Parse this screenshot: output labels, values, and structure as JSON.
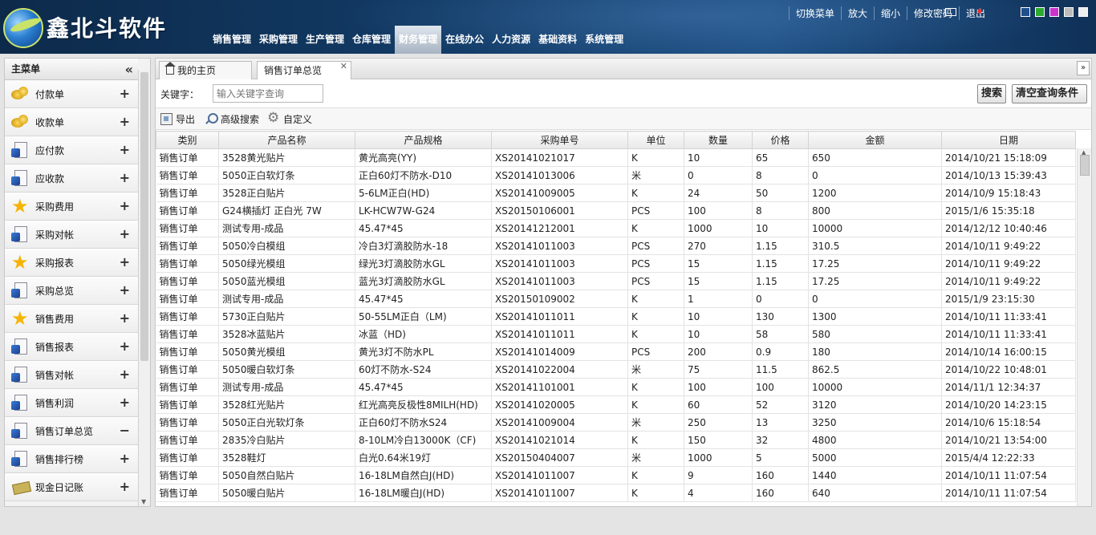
{
  "header": {
    "logo_text": "鑫北斗软件",
    "top_links": [
      "切换菜单",
      "放大",
      "缩小",
      "修改密码",
      "退出"
    ],
    "nav": [
      "销售管理",
      "采购管理",
      "生产管理",
      "仓库管理",
      "财务管理",
      "在线办公",
      "人力资源",
      "基础资料",
      "系统管理"
    ],
    "active_nav": "财务管理",
    "theme_colors": [
      "#1f4f8a",
      "#2ea82e",
      "#cc33cc",
      "#bbbbbb",
      "#eeeeee"
    ]
  },
  "sidebar": {
    "title": "主菜单",
    "items": [
      {
        "label": "付款单",
        "icon": "coins-icon",
        "state": "+"
      },
      {
        "label": "收款单",
        "icon": "coins-icon",
        "state": "+"
      },
      {
        "label": "应付款",
        "icon": "document-icon",
        "state": "+"
      },
      {
        "label": "应收款",
        "icon": "document-icon",
        "state": "+"
      },
      {
        "label": "采购费用",
        "icon": "star-icon",
        "state": "+"
      },
      {
        "label": "采购对帐",
        "icon": "document-icon",
        "state": "+"
      },
      {
        "label": "采购报表",
        "icon": "star-icon",
        "state": "+"
      },
      {
        "label": "采购总览",
        "icon": "document-icon",
        "state": "+"
      },
      {
        "label": "销售费用",
        "icon": "star-icon",
        "state": "+"
      },
      {
        "label": "销售报表",
        "icon": "document-icon",
        "state": "+"
      },
      {
        "label": "销售对帐",
        "icon": "document-icon",
        "state": "+"
      },
      {
        "label": "销售利润",
        "icon": "document-icon",
        "state": "+"
      },
      {
        "label": "销售订单总览",
        "icon": "document-icon",
        "state": "−"
      },
      {
        "label": "销售排行榜",
        "icon": "document-icon",
        "state": "+"
      },
      {
        "label": "现金日记账",
        "icon": "cash-icon",
        "state": "+"
      }
    ]
  },
  "tabs": {
    "home": "我的主页",
    "sales": "销售订单总览"
  },
  "search": {
    "label": "关键字：",
    "placeholder": "输入关键字查询",
    "search_btn": "搜索",
    "clear_btn": "清空查询条件"
  },
  "toolbar": {
    "export": "导出",
    "advanced": "高级搜索",
    "custom": "自定义"
  },
  "table": {
    "columns": [
      "类别",
      "产品名称",
      "产品规格",
      "采购单号",
      "单位",
      "数量",
      "价格",
      "金额",
      "日期"
    ],
    "rows": [
      [
        "销售订单",
        "3528黄光贴片",
        "黄光高亮(YY)",
        "XS20141021017",
        "K",
        "10",
        "65",
        "650",
        "2014/10/21 15:18:09"
      ],
      [
        "销售订单",
        "5050正白软灯条",
        "正白60灯不防水-D10",
        "XS20141013006",
        "米",
        "0",
        "8",
        "0",
        "2014/10/13 15:39:43"
      ],
      [
        "销售订单",
        "3528正白贴片",
        "5-6LM正白(HD)",
        "XS20141009005",
        "K",
        "24",
        "50",
        "1200",
        "2014/10/9 15:18:43"
      ],
      [
        "销售订单",
        "G24横插灯 正白光 7W",
        "LK-HCW7W-G24",
        "XS20150106001",
        "PCS",
        "100",
        "8",
        "800",
        "2015/1/6 15:35:18"
      ],
      [
        "销售订单",
        "测试专用-成品",
        "45.47*45",
        "XS20141212001",
        "K",
        "1000",
        "10",
        "10000",
        "2014/12/12 10:40:46"
      ],
      [
        "销售订单",
        "5050冷白模组",
        "冷白3灯滴胶防水-18",
        "XS20141011003",
        "PCS",
        "270",
        "1.15",
        "310.5",
        "2014/10/11 9:49:22"
      ],
      [
        "销售订单",
        "5050绿光模组",
        "绿光3灯滴胶防水GL",
        "XS20141011003",
        "PCS",
        "15",
        "1.15",
        "17.25",
        "2014/10/11 9:49:22"
      ],
      [
        "销售订单",
        "5050蓝光模组",
        "蓝光3灯滴胶防水GL",
        "XS20141011003",
        "PCS",
        "15",
        "1.15",
        "17.25",
        "2014/10/11 9:49:22"
      ],
      [
        "销售订单",
        "测试专用-成品",
        "45.47*45",
        "XS20150109002",
        "K",
        "1",
        "0",
        "0",
        "2015/1/9 23:15:30"
      ],
      [
        "销售订单",
        "5730正白贴片",
        "50-55LM正白（LM)",
        "XS20141011011",
        "K",
        "10",
        "130",
        "1300",
        "2014/10/11 11:33:41"
      ],
      [
        "销售订单",
        "3528冰蓝贴片",
        "冰蓝（HD)",
        "XS20141011011",
        "K",
        "10",
        "58",
        "580",
        "2014/10/11 11:33:41"
      ],
      [
        "销售订单",
        "5050黄光模组",
        "黄光3灯不防水PL",
        "XS20141014009",
        "PCS",
        "200",
        "0.9",
        "180",
        "2014/10/14 16:00:15"
      ],
      [
        "销售订单",
        "5050暖白软灯条",
        "60灯不防水-S24",
        "XS20141022004",
        "米",
        "75",
        "11.5",
        "862.5",
        "2014/10/22 10:48:01"
      ],
      [
        "销售订单",
        "测试专用-成品",
        "45.47*45",
        "XS20141101001",
        "K",
        "100",
        "100",
        "10000",
        "2014/11/1 12:34:37"
      ],
      [
        "销售订单",
        "3528红光贴片",
        "红光高亮反极性8MILH(HD)",
        "XS20141020005",
        "K",
        "60",
        "52",
        "3120",
        "2014/10/20 14:23:15"
      ],
      [
        "销售订单",
        "5050正白光软灯条",
        "正白60灯不防水S24",
        "XS20141009004",
        "米",
        "250",
        "13",
        "3250",
        "2014/10/6 15:18:54"
      ],
      [
        "销售订单",
        "2835冷白贴片",
        "8-10LM冷白13000K（CF)",
        "XS20141021014",
        "K",
        "150",
        "32",
        "4800",
        "2014/10/21 13:54:00"
      ],
      [
        "销售订单",
        "3528鞋灯",
        "白光0.64米19灯",
        "XS20150404007",
        "米",
        "1000",
        "5",
        "5000",
        "2015/4/4 12:22:33"
      ],
      [
        "销售订单",
        "5050自然白贴片",
        "16-18LM自然白J(HD)",
        "XS20141011007",
        "K",
        "9",
        "160",
        "1440",
        "2014/10/11 11:07:54"
      ],
      [
        "销售订单",
        "5050暖白贴片",
        "16-18LM暖白J(HD)",
        "XS20141011007",
        "K",
        "4",
        "160",
        "640",
        "2014/10/11 11:07:54"
      ]
    ]
  }
}
